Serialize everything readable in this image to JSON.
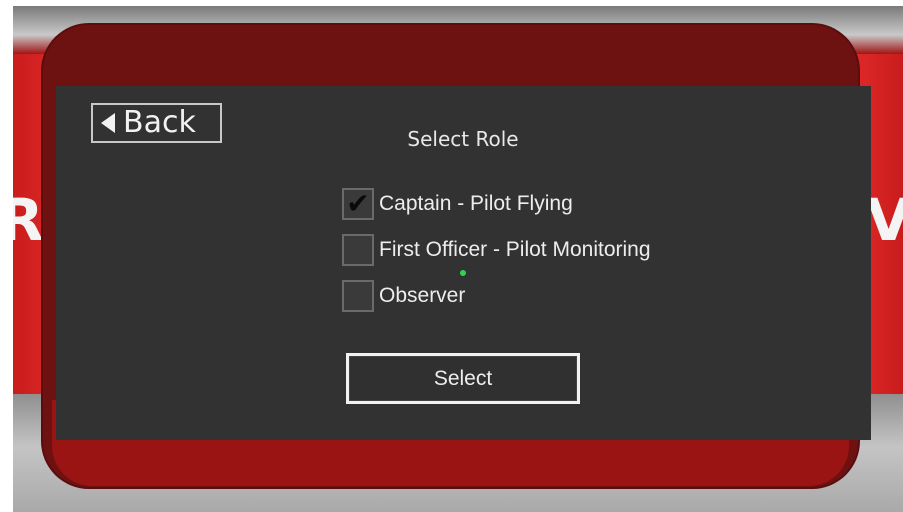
{
  "background": {
    "wall_text_left": "R",
    "wall_text_right": "V",
    "wall_color": "#b31515",
    "floor_color": "#b5b5b5"
  },
  "panel": {
    "frame_color": "#6e1111",
    "screen_color": "#323232"
  },
  "back_button": {
    "icon": "triangle-left-icon",
    "label": "Back"
  },
  "title": "Select Role",
  "options": [
    {
      "label": "Captain - Pilot Flying",
      "checked": true
    },
    {
      "label": "First Officer - Pilot Monitoring",
      "checked": false
    },
    {
      "label": "Observer",
      "checked": false
    }
  ],
  "checkmark_glyph": "✔",
  "select_button": {
    "label": "Select"
  },
  "pointer": {
    "icon": "cursor-dot-icon",
    "color": "#2ed352"
  }
}
